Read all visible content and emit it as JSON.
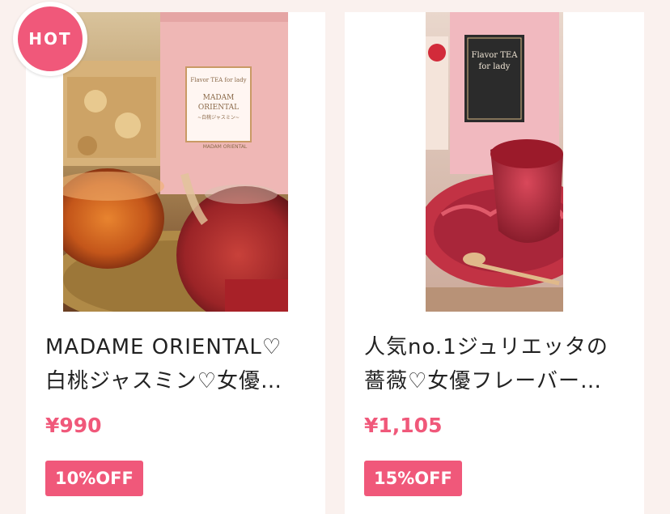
{
  "hot_badge": {
    "label": "HOT"
  },
  "products": [
    {
      "title_lines": [
        "MADAME ORIENTAL♡",
        "白桃ジャスミン♡女優…"
      ],
      "price": "¥990",
      "discount": "10%OFF",
      "package_text": [
        "Flavor TEA for lady",
        "MADAM",
        "ORIENTAL",
        "~白桃ジャスミン~",
        "MADAM ORIENTAL"
      ]
    },
    {
      "title_lines": [
        "人気no.1ジュリエッタの",
        "薔薇♡女優フレーバー…"
      ],
      "price": "¥1,105",
      "discount": "15%OFF",
      "package_text": [
        "Flavor TEA",
        "for lady"
      ]
    }
  ]
}
